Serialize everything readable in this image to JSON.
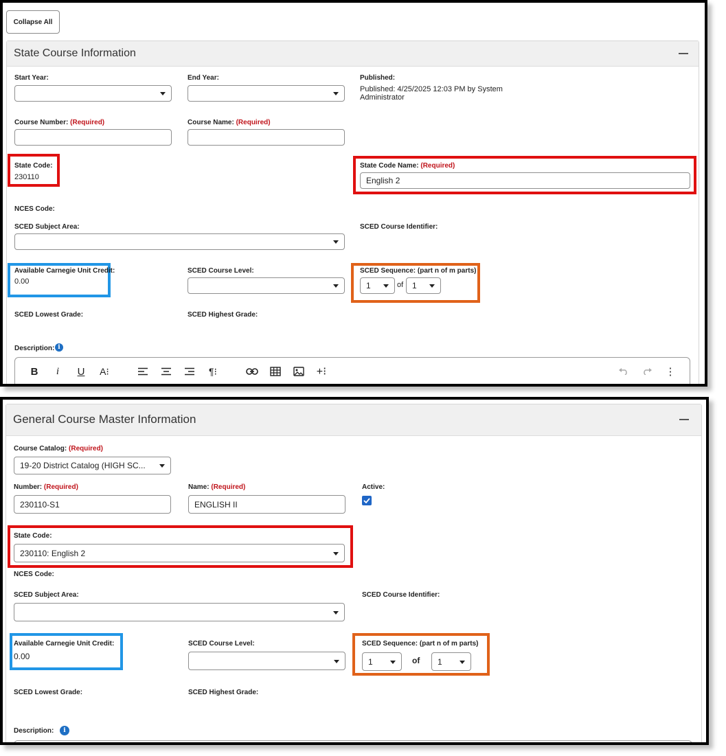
{
  "top": {
    "collapse_all_label": "Collapse All",
    "panel_title": "State Course Information",
    "start_year": {
      "label": "Start Year:",
      "value": ""
    },
    "end_year": {
      "label": "End Year:",
      "value": ""
    },
    "published": {
      "label": "Published:",
      "value": "Published: 4/25/2025 12:03 PM by System Administrator"
    },
    "course_number": {
      "label": "Course Number:",
      "required": "(Required)",
      "value": ""
    },
    "course_name": {
      "label": "Course Name:",
      "required": "(Required)",
      "value": ""
    },
    "state_code": {
      "label": "State Code:",
      "value": "230110"
    },
    "state_code_name": {
      "label": "State Code Name:",
      "required": "(Required)",
      "value": "English 2"
    },
    "nces_code": {
      "label": "NCES Code:"
    },
    "sced_subject_area": {
      "label": "SCED Subject Area:",
      "value": ""
    },
    "sced_course_identifier": {
      "label": "SCED Course Identifier:"
    },
    "carnegie_credit": {
      "label": "Available Carnegie Unit Credit:",
      "value": "0.00"
    },
    "sced_course_level": {
      "label": "SCED Course Level:",
      "value": ""
    },
    "sced_sequence": {
      "label": "SCED Sequence: (part n of m parts)",
      "n": "1",
      "of": "of",
      "m": "1"
    },
    "sced_lowest_grade": {
      "label": "SCED Lowest Grade:"
    },
    "sced_highest_grade": {
      "label": "SCED Highest Grade:"
    },
    "description": {
      "label": "Description:"
    },
    "toolbar": {
      "bold": "B",
      "italic": "i",
      "underline": "U",
      "font_size": "A⁝",
      "paragraph": "¶⁝",
      "insert_more": "+⁝",
      "more": "⋮"
    }
  },
  "bottom": {
    "panel_title": "General Course Master Information",
    "course_catalog": {
      "label": "Course Catalog:",
      "required": "(Required)",
      "value": "19-20 District Catalog (HIGH SC..."
    },
    "number": {
      "label": "Number:",
      "required": "(Required)",
      "value": "230110-S1"
    },
    "name": {
      "label": "Name:",
      "required": "(Required)",
      "value": "ENGLISH II"
    },
    "active": {
      "label": "Active:",
      "checked": true
    },
    "state_code": {
      "label": "State Code:",
      "value": "230110: English 2"
    },
    "nces_code": {
      "label": "NCES Code:"
    },
    "sced_subject_area": {
      "label": "SCED Subject Area:",
      "value": ""
    },
    "sced_course_identifier": {
      "label": "SCED Course Identifier:"
    },
    "carnegie_credit": {
      "label": "Available Carnegie Unit Credit:",
      "value": "0.00"
    },
    "sced_course_level": {
      "label": "SCED Course Level:",
      "value": ""
    },
    "sced_sequence": {
      "label": "SCED Sequence: (part n of m parts)",
      "n": "1",
      "of": "of",
      "m": "1"
    },
    "sced_lowest_grade": {
      "label": "SCED Lowest Grade:"
    },
    "sced_highest_grade": {
      "label": "SCED Highest Grade:"
    },
    "description": {
      "label": "Description:"
    }
  },
  "colors": {
    "required": "#c0141b",
    "highlight_red": "#e01010",
    "highlight_blue": "#2196e6",
    "highlight_orange": "#e0621a",
    "info_icon": "#1e6fc4",
    "checkbox": "#1f66c6"
  }
}
